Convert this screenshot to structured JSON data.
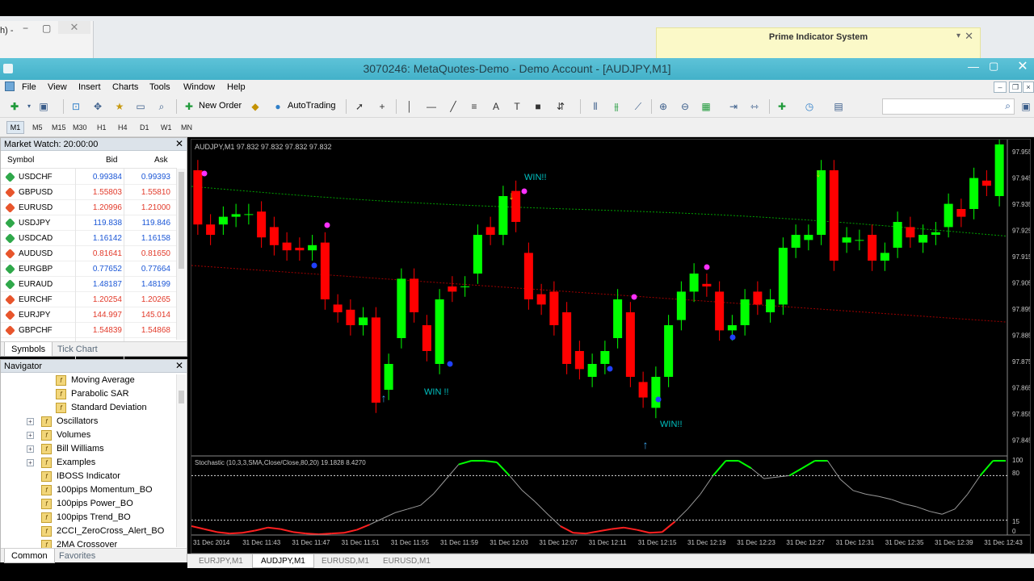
{
  "background_window": {
    "title_fragment": "h) -",
    "close": "✕"
  },
  "notification": {
    "title": "Prime Indicator System"
  },
  "window": {
    "title": "3070246: MetaQuotes-Demo - Demo Account - [AUDJPY,M1]"
  },
  "menu": [
    "File",
    "View",
    "Insert",
    "Charts",
    "Tools",
    "Window",
    "Help"
  ],
  "toolbar": {
    "new_order": "New Order",
    "autotrading": "AutoTrading"
  },
  "timeframes": [
    "M1",
    "M5",
    "M15",
    "M30",
    "H1",
    "H4",
    "D1",
    "W1",
    "MN"
  ],
  "market_watch": {
    "title": "Market Watch: 20:00:00",
    "columns": [
      "Symbol",
      "Bid",
      "Ask"
    ],
    "rows": [
      {
        "symbol": "USDCHF",
        "bid": "0.99384",
        "ask": "0.99393",
        "dir": "up"
      },
      {
        "symbol": "GBPUSD",
        "bid": "1.55803",
        "ask": "1.55810",
        "dir": "down"
      },
      {
        "symbol": "EURUSD",
        "bid": "1.20996",
        "ask": "1.21000",
        "dir": "down"
      },
      {
        "symbol": "USDJPY",
        "bid": "119.838",
        "ask": "119.846",
        "dir": "up"
      },
      {
        "symbol": "USDCAD",
        "bid": "1.16142",
        "ask": "1.16158",
        "dir": "up"
      },
      {
        "symbol": "AUDUSD",
        "bid": "0.81641",
        "ask": "0.81650",
        "dir": "down"
      },
      {
        "symbol": "EURGBP",
        "bid": "0.77652",
        "ask": "0.77664",
        "dir": "up"
      },
      {
        "symbol": "EURAUD",
        "bid": "1.48187",
        "ask": "1.48199",
        "dir": "up"
      },
      {
        "symbol": "EURCHF",
        "bid": "1.20254",
        "ask": "1.20265",
        "dir": "down"
      },
      {
        "symbol": "EURJPY",
        "bid": "144.997",
        "ask": "145.014",
        "dir": "down"
      },
      {
        "symbol": "GBPCHF",
        "bid": "1.54839",
        "ask": "1.54868",
        "dir": "down"
      }
    ],
    "tabs": [
      "Symbols",
      "Tick Chart"
    ]
  },
  "navigator": {
    "title": "Navigator",
    "items": [
      {
        "label": "Moving Average",
        "level": 2,
        "kind": "indicator"
      },
      {
        "label": "Parabolic SAR",
        "level": 2,
        "kind": "indicator"
      },
      {
        "label": "Standard Deviation",
        "level": 2,
        "kind": "indicator"
      },
      {
        "label": "Oscillators",
        "level": 1,
        "kind": "folder"
      },
      {
        "label": "Volumes",
        "level": 1,
        "kind": "folder"
      },
      {
        "label": "Bill Williams",
        "level": 1,
        "kind": "folder"
      },
      {
        "label": "Examples",
        "level": 1,
        "kind": "folder"
      },
      {
        "label": "IBOSS Indicator",
        "level": 1,
        "kind": "indicator"
      },
      {
        "label": "100pips Momentum_BO",
        "level": 1,
        "kind": "indicator"
      },
      {
        "label": "100pips Power_BO",
        "level": 1,
        "kind": "indicator"
      },
      {
        "label": "100pips Trend_BO",
        "level": 1,
        "kind": "indicator"
      },
      {
        "label": "2CCI_ZeroCross_Alert_BO",
        "level": 1,
        "kind": "indicator"
      },
      {
        "label": "2MA Crossover",
        "level": 1,
        "kind": "indicator"
      }
    ],
    "tabs": [
      "Common",
      "Favorites"
    ]
  },
  "chart": {
    "header": "AUDJPY,M1  97.832 97.832 97.832 97.832",
    "price_labels": [
      "97.955",
      "97.945",
      "97.935",
      "97.925",
      "97.915",
      "97.905",
      "97.895",
      "97.885",
      "97.875",
      "97.865",
      "97.855",
      "97.845"
    ],
    "annotations": [
      "WIN!!",
      "WIN !!",
      "WIN!!"
    ],
    "oscillator_header": "Stochastic (10,3,3,SMA,Close/Close,80,20) 19.1828 8.4270",
    "oscillator_levels": [
      "100",
      "80",
      "15",
      "0"
    ],
    "time_labels": [
      "31 Dec 2014",
      "31 Dec 11:43",
      "31 Dec 11:47",
      "31 Dec 11:51",
      "31 Dec 11:55",
      "31 Dec 11:59",
      "31 Dec 12:03",
      "31 Dec 12:07",
      "31 Dec 12:11",
      "31 Dec 12:15",
      "31 Dec 12:19",
      "31 Dec 12:23",
      "31 Dec 12:27",
      "31 Dec 12:31",
      "31 Dec 12:35",
      "31 Dec 12:39",
      "31 Dec 12:43"
    ],
    "tabs": [
      "EURJPY,M1",
      "AUDJPY,M1",
      "EURUSD,M1",
      "EURUSD,M1"
    ],
    "active_tab": 1,
    "colors": {
      "bull": "#00ff00",
      "bear": "#ff0000",
      "text": "#00c0c0",
      "up_arrow": "#3aa0e6",
      "down_arrow": "#e8c000"
    }
  },
  "chart_data": {
    "type": "candlestick",
    "symbol": "AUDJPY",
    "timeframe": "M1",
    "ylim": [
      97.84,
      97.96
    ],
    "candles": [
      {
        "o": 97.95,
        "c": 97.929
      },
      {
        "o": 97.929,
        "c": 97.925
      },
      {
        "o": 97.929,
        "c": 97.932
      },
      {
        "o": 97.932,
        "c": 97.933
      },
      {
        "o": 97.933,
        "c": 97.933
      },
      {
        "o": 97.934,
        "c": 97.924
      },
      {
        "o": 97.928,
        "c": 97.921
      },
      {
        "o": 97.922,
        "c": 97.919
      },
      {
        "o": 97.92,
        "c": 97.919
      },
      {
        "o": 97.919,
        "c": 97.921
      },
      {
        "o": 97.922,
        "c": 97.9
      },
      {
        "o": 97.898,
        "c": 97.895
      },
      {
        "o": 97.896,
        "c": 97.89
      },
      {
        "o": 97.89,
        "c": 97.893
      },
      {
        "o": 97.893,
        "c": 97.86
      },
      {
        "o": 97.865,
        "c": 97.875
      },
      {
        "o": 97.885,
        "c": 97.908
      },
      {
        "o": 97.908,
        "c": 97.895
      },
      {
        "o": 97.89,
        "c": 97.88
      },
      {
        "o": 97.875,
        "c": 97.9
      },
      {
        "o": 97.905,
        "c": 97.903
      },
      {
        "o": 97.905,
        "c": 97.905
      },
      {
        "o": 97.91,
        "c": 97.925
      },
      {
        "o": 97.928,
        "c": 97.925
      },
      {
        "o": 97.925,
        "c": 97.94
      },
      {
        "o": 97.942,
        "c": 97.93
      },
      {
        "o": 97.918,
        "c": 97.9
      },
      {
        "o": 97.902,
        "c": 97.898
      },
      {
        "o": 97.903,
        "c": 97.89
      },
      {
        "o": 97.895,
        "c": 97.875
      },
      {
        "o": 97.88,
        "c": 97.873
      },
      {
        "o": 97.87,
        "c": 97.875
      },
      {
        "o": 97.875,
        "c": 97.88
      },
      {
        "o": 97.885,
        "c": 97.9
      },
      {
        "o": 97.895,
        "c": 97.87
      },
      {
        "o": 97.868,
        "c": 97.862
      },
      {
        "o": 97.858,
        "c": 97.87
      },
      {
        "o": 97.87,
        "c": 97.89
      },
      {
        "o": 97.892,
        "c": 97.903
      },
      {
        "o": 97.903,
        "c": 97.91
      },
      {
        "o": 97.906,
        "c": 97.905
      },
      {
        "o": 97.903,
        "c": 97.888
      },
      {
        "o": 97.888,
        "c": 97.89
      },
      {
        "o": 97.89,
        "c": 97.9
      },
      {
        "o": 97.903,
        "c": 97.898
      },
      {
        "o": 97.895,
        "c": 97.9
      },
      {
        "o": 97.898,
        "c": 97.92
      },
      {
        "o": 97.92,
        "c": 97.925
      },
      {
        "o": 97.923,
        "c": 97.925
      },
      {
        "o": 97.925,
        "c": 97.95
      },
      {
        "o": 97.95,
        "c": 97.915
      },
      {
        "o": 97.922,
        "c": 97.924
      },
      {
        "o": 97.923,
        "c": 97.923
      },
      {
        "o": 97.925,
        "c": 97.915
      },
      {
        "o": 97.915,
        "c": 97.918
      },
      {
        "o": 97.92,
        "c": 97.93
      },
      {
        "o": 97.928,
        "c": 97.924
      },
      {
        "o": 97.922,
        "c": 97.925
      },
      {
        "o": 97.925,
        "c": 97.926
      },
      {
        "o": 97.928,
        "c": 97.937
      },
      {
        "o": 97.935,
        "c": 97.932
      },
      {
        "o": 97.935,
        "c": 97.947
      },
      {
        "o": 97.946,
        "c": 97.944
      },
      {
        "o": 97.94,
        "c": 97.96
      }
    ],
    "stochastic": [
      12,
      8,
      4,
      2,
      3,
      6,
      10,
      8,
      4,
      2,
      1,
      2,
      3,
      7,
      14,
      22,
      30,
      35,
      40,
      55,
      75,
      95,
      100,
      100,
      98,
      80,
      60,
      45,
      28,
      12,
      3,
      2,
      5,
      8,
      10,
      7,
      3,
      4,
      18,
      35,
      55,
      80,
      100,
      100,
      90,
      76,
      78,
      80,
      90,
      100,
      100,
      75,
      60,
      55,
      52,
      48,
      42,
      38,
      32,
      28,
      35,
      55,
      80,
      100,
      100
    ]
  }
}
